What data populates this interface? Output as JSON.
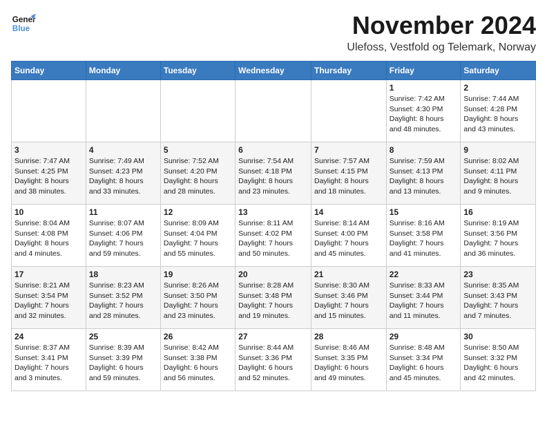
{
  "logo": {
    "line1": "General",
    "line2": "Blue"
  },
  "title": "November 2024",
  "subtitle": "Ulefoss, Vestfold og Telemark, Norway",
  "days_of_week": [
    "Sunday",
    "Monday",
    "Tuesday",
    "Wednesday",
    "Thursday",
    "Friday",
    "Saturday"
  ],
  "weeks": [
    [
      {
        "day": "",
        "info": ""
      },
      {
        "day": "",
        "info": ""
      },
      {
        "day": "",
        "info": ""
      },
      {
        "day": "",
        "info": ""
      },
      {
        "day": "",
        "info": ""
      },
      {
        "day": "1",
        "info": "Sunrise: 7:42 AM\nSunset: 4:30 PM\nDaylight: 8 hours\nand 48 minutes."
      },
      {
        "day": "2",
        "info": "Sunrise: 7:44 AM\nSunset: 4:28 PM\nDaylight: 8 hours\nand 43 minutes."
      }
    ],
    [
      {
        "day": "3",
        "info": "Sunrise: 7:47 AM\nSunset: 4:25 PM\nDaylight: 8 hours\nand 38 minutes."
      },
      {
        "day": "4",
        "info": "Sunrise: 7:49 AM\nSunset: 4:23 PM\nDaylight: 8 hours\nand 33 minutes."
      },
      {
        "day": "5",
        "info": "Sunrise: 7:52 AM\nSunset: 4:20 PM\nDaylight: 8 hours\nand 28 minutes."
      },
      {
        "day": "6",
        "info": "Sunrise: 7:54 AM\nSunset: 4:18 PM\nDaylight: 8 hours\nand 23 minutes."
      },
      {
        "day": "7",
        "info": "Sunrise: 7:57 AM\nSunset: 4:15 PM\nDaylight: 8 hours\nand 18 minutes."
      },
      {
        "day": "8",
        "info": "Sunrise: 7:59 AM\nSunset: 4:13 PM\nDaylight: 8 hours\nand 13 minutes."
      },
      {
        "day": "9",
        "info": "Sunrise: 8:02 AM\nSunset: 4:11 PM\nDaylight: 8 hours\nand 9 minutes."
      }
    ],
    [
      {
        "day": "10",
        "info": "Sunrise: 8:04 AM\nSunset: 4:08 PM\nDaylight: 8 hours\nand 4 minutes."
      },
      {
        "day": "11",
        "info": "Sunrise: 8:07 AM\nSunset: 4:06 PM\nDaylight: 7 hours\nand 59 minutes."
      },
      {
        "day": "12",
        "info": "Sunrise: 8:09 AM\nSunset: 4:04 PM\nDaylight: 7 hours\nand 55 minutes."
      },
      {
        "day": "13",
        "info": "Sunrise: 8:11 AM\nSunset: 4:02 PM\nDaylight: 7 hours\nand 50 minutes."
      },
      {
        "day": "14",
        "info": "Sunrise: 8:14 AM\nSunset: 4:00 PM\nDaylight: 7 hours\nand 45 minutes."
      },
      {
        "day": "15",
        "info": "Sunrise: 8:16 AM\nSunset: 3:58 PM\nDaylight: 7 hours\nand 41 minutes."
      },
      {
        "day": "16",
        "info": "Sunrise: 8:19 AM\nSunset: 3:56 PM\nDaylight: 7 hours\nand 36 minutes."
      }
    ],
    [
      {
        "day": "17",
        "info": "Sunrise: 8:21 AM\nSunset: 3:54 PM\nDaylight: 7 hours\nand 32 minutes."
      },
      {
        "day": "18",
        "info": "Sunrise: 8:23 AM\nSunset: 3:52 PM\nDaylight: 7 hours\nand 28 minutes."
      },
      {
        "day": "19",
        "info": "Sunrise: 8:26 AM\nSunset: 3:50 PM\nDaylight: 7 hours\nand 23 minutes."
      },
      {
        "day": "20",
        "info": "Sunrise: 8:28 AM\nSunset: 3:48 PM\nDaylight: 7 hours\nand 19 minutes."
      },
      {
        "day": "21",
        "info": "Sunrise: 8:30 AM\nSunset: 3:46 PM\nDaylight: 7 hours\nand 15 minutes."
      },
      {
        "day": "22",
        "info": "Sunrise: 8:33 AM\nSunset: 3:44 PM\nDaylight: 7 hours\nand 11 minutes."
      },
      {
        "day": "23",
        "info": "Sunrise: 8:35 AM\nSunset: 3:43 PM\nDaylight: 7 hours\nand 7 minutes."
      }
    ],
    [
      {
        "day": "24",
        "info": "Sunrise: 8:37 AM\nSunset: 3:41 PM\nDaylight: 7 hours\nand 3 minutes."
      },
      {
        "day": "25",
        "info": "Sunrise: 8:39 AM\nSunset: 3:39 PM\nDaylight: 6 hours\nand 59 minutes."
      },
      {
        "day": "26",
        "info": "Sunrise: 8:42 AM\nSunset: 3:38 PM\nDaylight: 6 hours\nand 56 minutes."
      },
      {
        "day": "27",
        "info": "Sunrise: 8:44 AM\nSunset: 3:36 PM\nDaylight: 6 hours\nand 52 minutes."
      },
      {
        "day": "28",
        "info": "Sunrise: 8:46 AM\nSunset: 3:35 PM\nDaylight: 6 hours\nand 49 minutes."
      },
      {
        "day": "29",
        "info": "Sunrise: 8:48 AM\nSunset: 3:34 PM\nDaylight: 6 hours\nand 45 minutes."
      },
      {
        "day": "30",
        "info": "Sunrise: 8:50 AM\nSunset: 3:32 PM\nDaylight: 6 hours\nand 42 minutes."
      }
    ]
  ]
}
